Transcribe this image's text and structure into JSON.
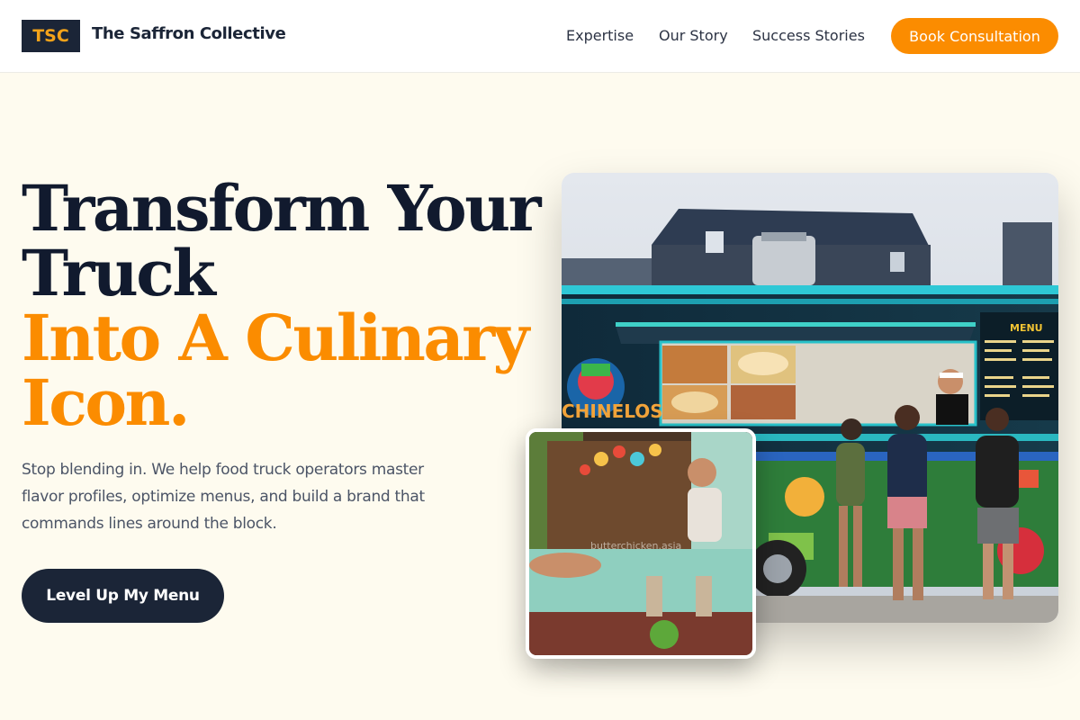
{
  "header": {
    "logo_mark": "TSC",
    "logo_name": "The Saffron Collective",
    "nav": [
      "Expertise",
      "Our Story",
      "Success Stories"
    ],
    "cta": "Book Consultation"
  },
  "hero": {
    "headline_dark": [
      "Transform Your",
      "Truck"
    ],
    "headline_accent": [
      "Into A Culinary",
      "Icon."
    ],
    "subtext": "Stop blending in. We help food truck operators master flavor profiles, optimize menus, and build a brand that commands lines around the block.",
    "button": "Level Up My Menu"
  },
  "images": {
    "main": {
      "truck_sign": "CHINELOS",
      "menu_heading": "MENU"
    },
    "inset": {
      "watermark": "butterchicken.asia"
    }
  },
  "colors": {
    "accent": "#fb8c00",
    "navy": "#1b2537",
    "background": "#fefbef"
  }
}
